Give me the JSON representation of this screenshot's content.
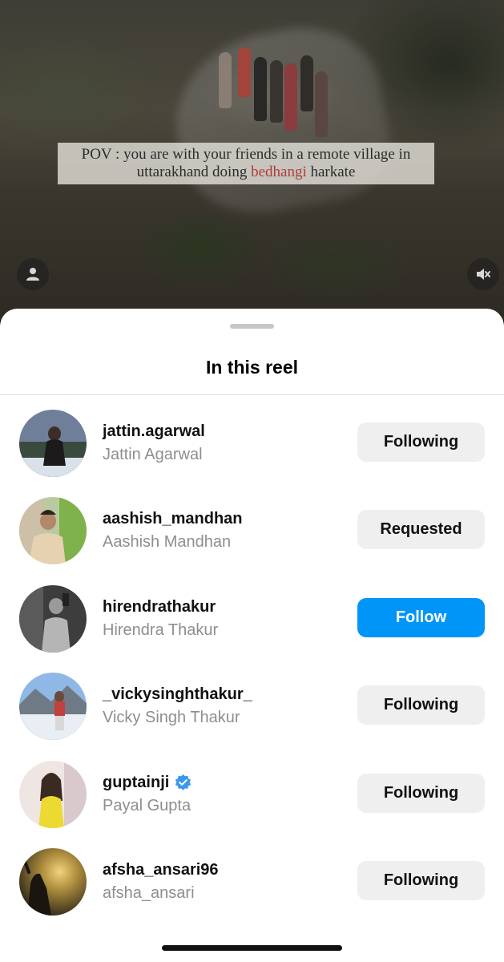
{
  "video": {
    "caption_before": "POV : you are with your friends in a remote village in",
    "caption_line2_before": "uttarakhand doing ",
    "caption_highlight": "bedhangi",
    "caption_after": " harkate",
    "highlight_color": "#b23b3b",
    "left_icon": "person-icon",
    "right_icon": "muted-speaker-icon"
  },
  "sheet": {
    "title": "In this reel"
  },
  "accounts": [
    {
      "username": "jattin.agarwal",
      "full_name": "Jattin Agarwal",
      "button": "Following",
      "button_style": "secondary",
      "verified": false
    },
    {
      "username": "aashish_mandhan",
      "full_name": "Aashish Mandhan",
      "button": "Requested",
      "button_style": "secondary",
      "verified": false
    },
    {
      "username": "hirendrathakur",
      "full_name": "Hirendra Thakur",
      "button": "Follow",
      "button_style": "primary",
      "verified": false
    },
    {
      "username": "_vickysinghthakur_",
      "full_name": "Vicky Singh Thakur",
      "button": "Following",
      "button_style": "secondary",
      "verified": false
    },
    {
      "username": "guptainji",
      "full_name": "Payal Gupta",
      "button": "Following",
      "button_style": "secondary",
      "verified": true
    },
    {
      "username": "afsha_ansari96",
      "full_name": "afsha_ansari",
      "button": "Following",
      "button_style": "secondary",
      "verified": false
    }
  ],
  "colors": {
    "primary_button": "#0095f6",
    "secondary_button": "#efefef",
    "verified_badge": "#3897f0",
    "secondary_text": "#8e8e8e"
  }
}
